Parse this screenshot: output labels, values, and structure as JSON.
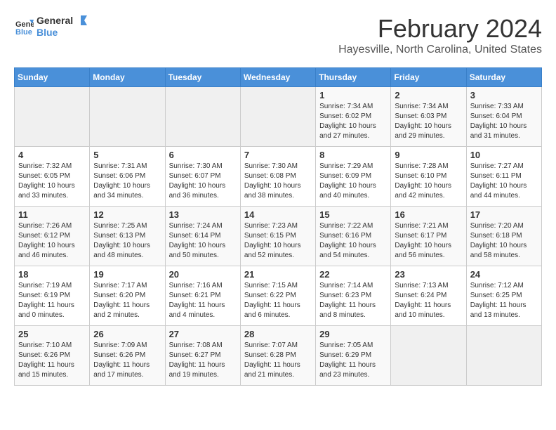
{
  "header": {
    "logo_general": "General",
    "logo_blue": "Blue",
    "month": "February 2024",
    "location": "Hayesville, North Carolina, United States"
  },
  "days_of_week": [
    "Sunday",
    "Monday",
    "Tuesday",
    "Wednesday",
    "Thursday",
    "Friday",
    "Saturday"
  ],
  "weeks": [
    [
      {
        "day": "",
        "info": ""
      },
      {
        "day": "",
        "info": ""
      },
      {
        "day": "",
        "info": ""
      },
      {
        "day": "",
        "info": ""
      },
      {
        "day": "1",
        "info": "Sunrise: 7:34 AM\nSunset: 6:02 PM\nDaylight: 10 hours\nand 27 minutes."
      },
      {
        "day": "2",
        "info": "Sunrise: 7:34 AM\nSunset: 6:03 PM\nDaylight: 10 hours\nand 29 minutes."
      },
      {
        "day": "3",
        "info": "Sunrise: 7:33 AM\nSunset: 6:04 PM\nDaylight: 10 hours\nand 31 minutes."
      }
    ],
    [
      {
        "day": "4",
        "info": "Sunrise: 7:32 AM\nSunset: 6:05 PM\nDaylight: 10 hours\nand 33 minutes."
      },
      {
        "day": "5",
        "info": "Sunrise: 7:31 AM\nSunset: 6:06 PM\nDaylight: 10 hours\nand 34 minutes."
      },
      {
        "day": "6",
        "info": "Sunrise: 7:30 AM\nSunset: 6:07 PM\nDaylight: 10 hours\nand 36 minutes."
      },
      {
        "day": "7",
        "info": "Sunrise: 7:30 AM\nSunset: 6:08 PM\nDaylight: 10 hours\nand 38 minutes."
      },
      {
        "day": "8",
        "info": "Sunrise: 7:29 AM\nSunset: 6:09 PM\nDaylight: 10 hours\nand 40 minutes."
      },
      {
        "day": "9",
        "info": "Sunrise: 7:28 AM\nSunset: 6:10 PM\nDaylight: 10 hours\nand 42 minutes."
      },
      {
        "day": "10",
        "info": "Sunrise: 7:27 AM\nSunset: 6:11 PM\nDaylight: 10 hours\nand 44 minutes."
      }
    ],
    [
      {
        "day": "11",
        "info": "Sunrise: 7:26 AM\nSunset: 6:12 PM\nDaylight: 10 hours\nand 46 minutes."
      },
      {
        "day": "12",
        "info": "Sunrise: 7:25 AM\nSunset: 6:13 PM\nDaylight: 10 hours\nand 48 minutes."
      },
      {
        "day": "13",
        "info": "Sunrise: 7:24 AM\nSunset: 6:14 PM\nDaylight: 10 hours\nand 50 minutes."
      },
      {
        "day": "14",
        "info": "Sunrise: 7:23 AM\nSunset: 6:15 PM\nDaylight: 10 hours\nand 52 minutes."
      },
      {
        "day": "15",
        "info": "Sunrise: 7:22 AM\nSunset: 6:16 PM\nDaylight: 10 hours\nand 54 minutes."
      },
      {
        "day": "16",
        "info": "Sunrise: 7:21 AM\nSunset: 6:17 PM\nDaylight: 10 hours\nand 56 minutes."
      },
      {
        "day": "17",
        "info": "Sunrise: 7:20 AM\nSunset: 6:18 PM\nDaylight: 10 hours\nand 58 minutes."
      }
    ],
    [
      {
        "day": "18",
        "info": "Sunrise: 7:19 AM\nSunset: 6:19 PM\nDaylight: 11 hours\nand 0 minutes."
      },
      {
        "day": "19",
        "info": "Sunrise: 7:17 AM\nSunset: 6:20 PM\nDaylight: 11 hours\nand 2 minutes."
      },
      {
        "day": "20",
        "info": "Sunrise: 7:16 AM\nSunset: 6:21 PM\nDaylight: 11 hours\nand 4 minutes."
      },
      {
        "day": "21",
        "info": "Sunrise: 7:15 AM\nSunset: 6:22 PM\nDaylight: 11 hours\nand 6 minutes."
      },
      {
        "day": "22",
        "info": "Sunrise: 7:14 AM\nSunset: 6:23 PM\nDaylight: 11 hours\nand 8 minutes."
      },
      {
        "day": "23",
        "info": "Sunrise: 7:13 AM\nSunset: 6:24 PM\nDaylight: 11 hours\nand 10 minutes."
      },
      {
        "day": "24",
        "info": "Sunrise: 7:12 AM\nSunset: 6:25 PM\nDaylight: 11 hours\nand 13 minutes."
      }
    ],
    [
      {
        "day": "25",
        "info": "Sunrise: 7:10 AM\nSunset: 6:26 PM\nDaylight: 11 hours\nand 15 minutes."
      },
      {
        "day": "26",
        "info": "Sunrise: 7:09 AM\nSunset: 6:26 PM\nDaylight: 11 hours\nand 17 minutes."
      },
      {
        "day": "27",
        "info": "Sunrise: 7:08 AM\nSunset: 6:27 PM\nDaylight: 11 hours\nand 19 minutes."
      },
      {
        "day": "28",
        "info": "Sunrise: 7:07 AM\nSunset: 6:28 PM\nDaylight: 11 hours\nand 21 minutes."
      },
      {
        "day": "29",
        "info": "Sunrise: 7:05 AM\nSunset: 6:29 PM\nDaylight: 11 hours\nand 23 minutes."
      },
      {
        "day": "",
        "info": ""
      },
      {
        "day": "",
        "info": ""
      }
    ]
  ]
}
